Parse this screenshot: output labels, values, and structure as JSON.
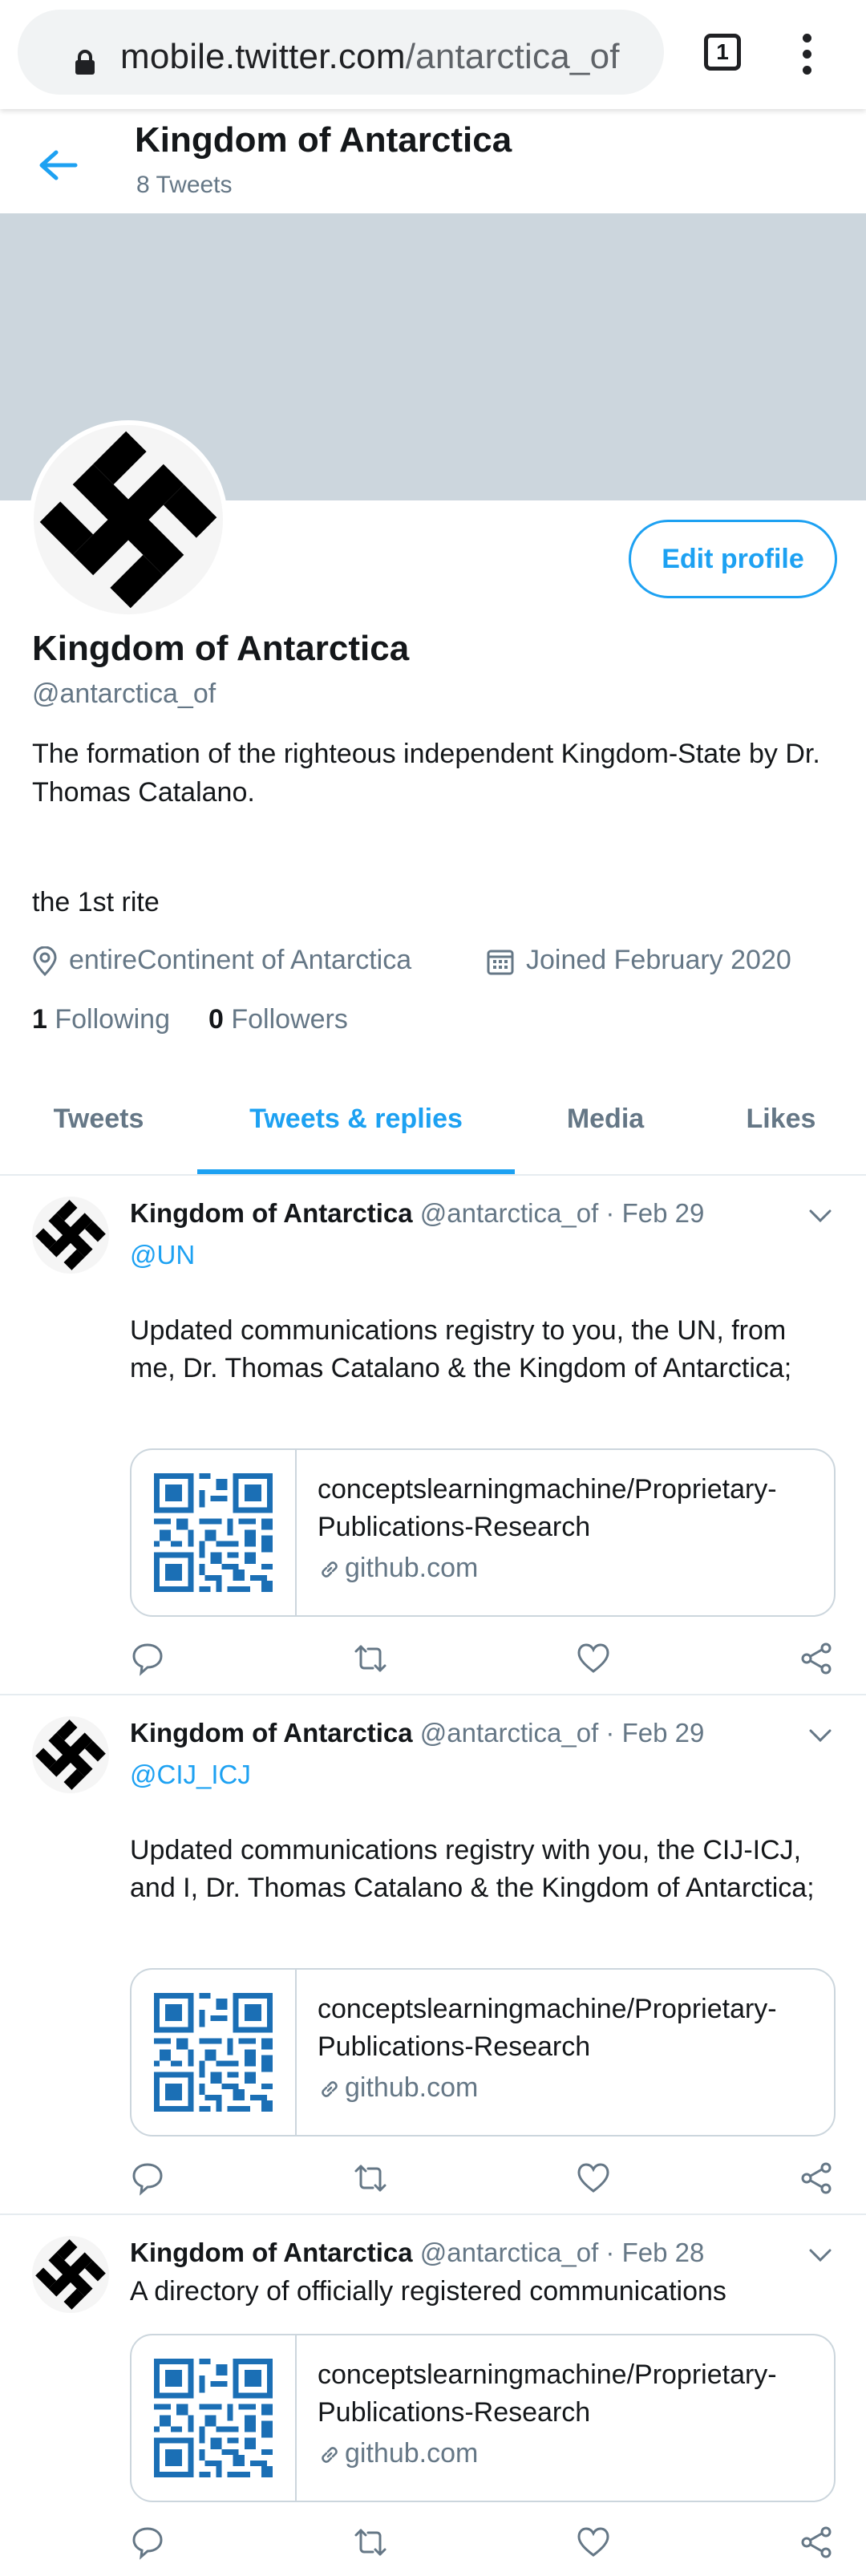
{
  "browser": {
    "url_host": "mobile.twitter.com",
    "url_path": "/antarctica_of",
    "tab_count": "1"
  },
  "header": {
    "name": "Kingdom of Antarctica",
    "tweet_count": "8 Tweets"
  },
  "profile": {
    "name": "Kingdom of Antarctica",
    "handle": "@antarctica_of",
    "edit_button": "Edit profile",
    "bio": "The formation of the righteous independent Kingdom-State by Dr. Thomas Catalano.",
    "bio_line2": "the 1st rite",
    "location": "entireContinent of Antarctica",
    "joined": "Joined February 2020",
    "following_count": "1",
    "following_label": "Following",
    "followers_count": "0",
    "followers_label": "Followers"
  },
  "tabs": [
    {
      "label": "Tweets",
      "active": false
    },
    {
      "label": "Tweets & replies",
      "active": true
    },
    {
      "label": "Media",
      "active": false
    },
    {
      "label": "Likes",
      "active": false
    }
  ],
  "tweets": [
    {
      "name": "Kingdom of Antarctica",
      "handle": "@antarctica_of",
      "date": "· Feb 29",
      "reply_to": "@UN",
      "text": "Updated communications registry to you, the UN, from me, Dr. Thomas Catalano & the Kingdom of Antarctica;",
      "card_title": "conceptslearningmachine/Proprietary-Publications-Research",
      "card_domain": "github.com"
    },
    {
      "name": "Kingdom of Antarctica",
      "handle": "@antarctica_of",
      "date": "· Feb 29",
      "reply_to": "@CIJ_ICJ",
      "text": "Updated communications registry with you, the CIJ-ICJ, and I, Dr. Thomas Catalano & the Kingdom of Antarctica;",
      "card_title": "conceptslearningmachine/Proprietary-Publications-Research",
      "card_domain": "github.com"
    },
    {
      "name": "Kingdom of Antarctica",
      "handle": "@antarctica_of",
      "date": "· Feb 28",
      "reply_to": "",
      "text": "A directory of officially registered communications",
      "card_title": "conceptslearningmachine/Proprietary-Publications-Research",
      "card_domain": "github.com"
    }
  ],
  "colors": {
    "accent": "#1da1f2",
    "banner": "#ccd6dd",
    "muted_text": "#657786",
    "qr": "#1b6fb5"
  },
  "icons": [
    "lock-icon",
    "menu-icon",
    "back-arrow-icon",
    "location-icon",
    "calendar-icon",
    "link-icon",
    "reply-icon",
    "retweet-icon",
    "like-icon",
    "share-icon",
    "caret-down-icon"
  ]
}
